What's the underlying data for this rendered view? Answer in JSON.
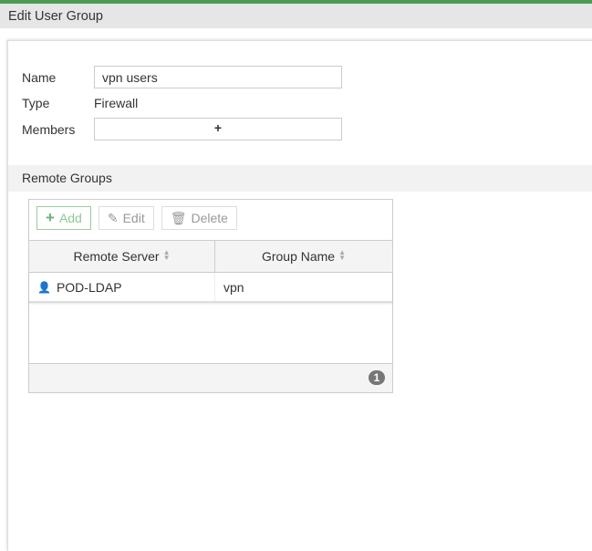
{
  "header": {
    "title": "Edit User Group"
  },
  "form": {
    "name_label": "Name",
    "name_value": "vpn users",
    "type_label": "Type",
    "type_value": "Firewall",
    "members_label": "Members",
    "members_add": "+"
  },
  "remote_groups": {
    "title": "Remote Groups",
    "toolbar": {
      "add": "Add",
      "edit": "Edit",
      "delete": "Delete"
    },
    "columns": [
      "Remote Server",
      "Group Name"
    ],
    "rows": [
      {
        "server": "POD-LDAP",
        "group": "vpn"
      }
    ],
    "count": "1"
  },
  "colors": {
    "accent": "#4c9a56"
  }
}
